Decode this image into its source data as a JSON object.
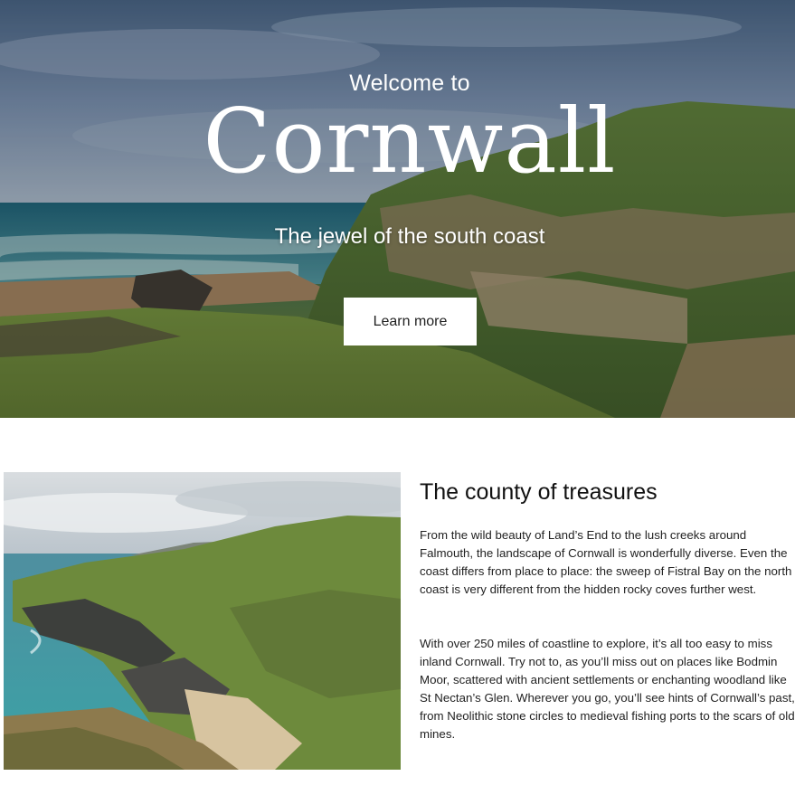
{
  "hero": {
    "kicker": "Welcome to",
    "title": "Cornwall",
    "subtitle": "The jewel of the south coast",
    "button_label": "Learn more"
  },
  "section": {
    "heading": "The county of treasures",
    "paragraphs": [
      "From the wild beauty of Land’s End to the lush creeks around Falmouth, the landscape of Cornwall is wonderfully diverse. Even the coast differs from place to place: the sweep of Fistral Bay on the north coast is very different from the hidden rocky coves further west.",
      "With over 250 miles of coastline to explore, it’s all too easy to miss inland Cornwall. Try not to, as you’ll miss out on places like Bodmin Moor, scattered with ancient settlements or enchanting woodland like St Nectan’s Glen. Wherever you go, you’ll see hints of Cornwall’s past, from Neolithic stone circles to medieval fishing ports to the scars of old mines."
    ]
  },
  "colors": {
    "sky": "#6c83a2",
    "sea": "#2f7f8f",
    "grass": "#5b7a3a",
    "button_bg": "#ffffff",
    "text": "#222222"
  }
}
